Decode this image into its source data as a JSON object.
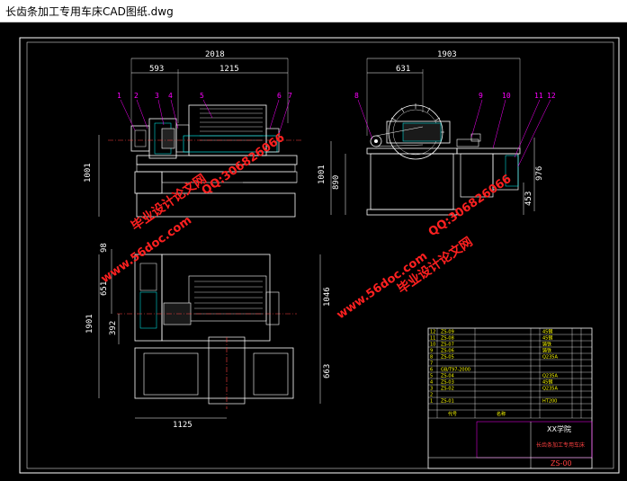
{
  "window": {
    "title": "长齿条加工专用车床CAD图纸.dwg"
  },
  "dimensions": {
    "front_total": "2018",
    "front_left": "593",
    "front_right": "1215",
    "front_height": "1001",
    "side_total": "1903",
    "side_left": "631",
    "side_height1": "1001",
    "side_height2": "890",
    "side_height3": "976",
    "side_height4": "453",
    "top_a": "98",
    "top_b": "651",
    "top_c": "392",
    "top_height": "1901",
    "top_right1": "1046",
    "top_right2": "663",
    "top_width": "1125"
  },
  "part_labels_front": [
    "1",
    "2",
    "3",
    "4",
    "5",
    "6",
    "7"
  ],
  "part_labels_side": [
    "8",
    "9",
    "10",
    "11",
    "12"
  ],
  "watermarks": {
    "site": "www.56doc.com",
    "qq": "QQ:306826066",
    "brand": "毕业设计论文网"
  },
  "title_block": {
    "rows": [
      {
        "no": "12",
        "code": "ZS-09"
      },
      {
        "no": "11",
        "code": "ZS-08"
      },
      {
        "no": "10",
        "code": "ZS-07"
      },
      {
        "no": "9",
        "code": "ZS-06"
      },
      {
        "no": "8",
        "code": "ZS-05"
      },
      {
        "no": "7",
        "code": ""
      },
      {
        "no": "6",
        "code": "GB/T97-2000"
      },
      {
        "no": "5",
        "code": "ZS-04"
      },
      {
        "no": "4",
        "code": "ZS-03"
      },
      {
        "no": "3",
        "code": "ZS-02"
      },
      {
        "no": "2",
        "code": ""
      },
      {
        "no": "1",
        "code": "ZS-01"
      }
    ],
    "materials": [
      "45钢",
      "45钢",
      "铸铁",
      "铸铁",
      "Q235A",
      "",
      "",
      "Q235A",
      "45钢",
      "Q235A",
      "",
      "HT200"
    ],
    "header_no": "代号",
    "header_name": "名称",
    "school": "XX学院",
    "drawing_title": "长齿条加工专用车床",
    "drawing_number": "ZS-00"
  }
}
